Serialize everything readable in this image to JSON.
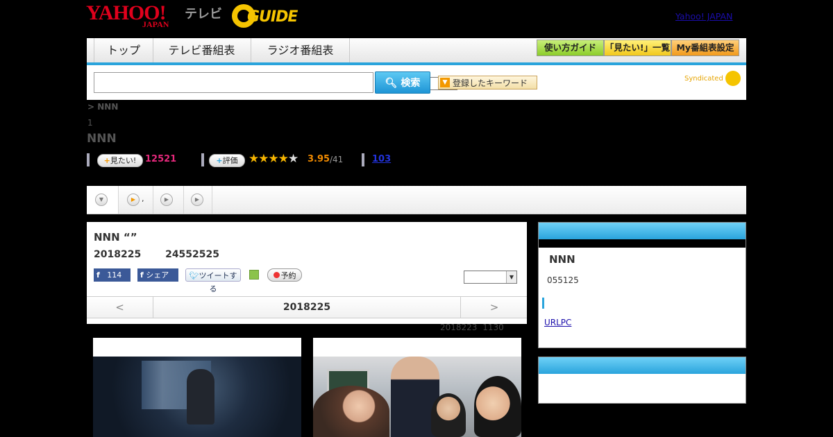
{
  "header": {
    "yahoo_logo": "YAHOO!",
    "yahoo_logo_sub": "JAPAN",
    "terebi_logo": "テレビ",
    "gguide_logo": "GUIDE",
    "yahoo_japan_link": "Yahoo! JAPAN"
  },
  "nav": {
    "tabs": [
      "トップ",
      "テレビ番組表",
      "ラジオ番組表"
    ],
    "buttons": [
      "使い方ガイド",
      "「見たい!」一覧",
      "My番組表設定"
    ]
  },
  "search": {
    "button_label": "検索",
    "keyword_button": "登録したキーワード",
    "syndicated": "Syndicated"
  },
  "program": {
    "breadcrumb": "> NNN",
    "episode_count": "1",
    "title": "NNN",
    "mitai_label": "見たい!",
    "mitai_count": "12521",
    "rating_label": "評価",
    "rating_score": "3.95",
    "rating_total": "/41",
    "rating_value": 3.95,
    "comment_count": "103"
  },
  "episode": {
    "title": "NNN “”",
    "date": "2018225",
    "time": "24552525",
    "fb_like_count": "114",
    "fb_share": "シェア",
    "tweet": "ツイートする",
    "reserve": "予約",
    "prev": "<",
    "current_date": "2018225",
    "next": ">",
    "updated": "2018223 1130"
  },
  "sidebar": {
    "station_name": "NNN",
    "station_time": "055125",
    "url_link": "URLPC"
  },
  "colors": {
    "accent_blue": "#2aa4dc",
    "mitai_pink": "#e4287b",
    "rating_orange": "#f08a00",
    "star_gold": "#f5b400"
  }
}
